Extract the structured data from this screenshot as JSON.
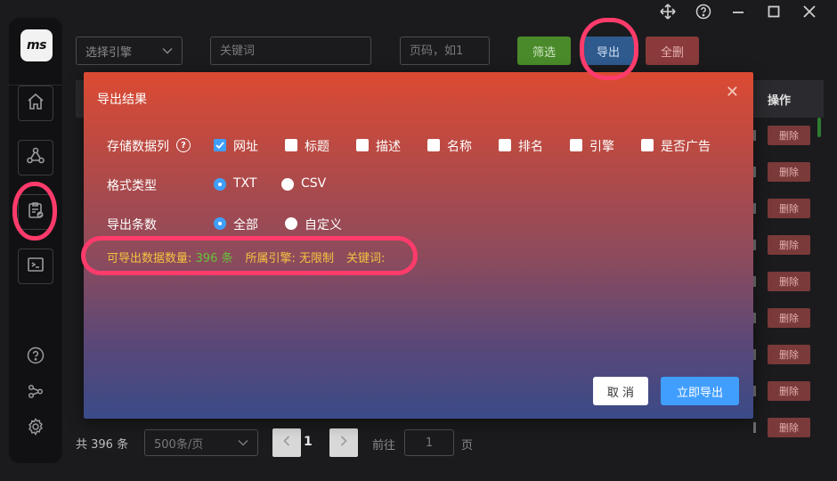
{
  "window_controls": [
    "move-icon",
    "help-circle-icon",
    "minimize-icon",
    "maximize-icon",
    "close-icon"
  ],
  "sidebar": {
    "logo_text": "ms",
    "items": [
      {
        "icon": "home-icon"
      },
      {
        "icon": "share-nodes-icon"
      },
      {
        "icon": "clipboard-check-icon",
        "active": true
      },
      {
        "icon": "terminal-icon"
      }
    ],
    "bottom_icons": [
      "question-circle-icon",
      "nodes-icon",
      "gear-icon"
    ]
  },
  "toolbar": {
    "engine_placeholder": "选择引擎",
    "keyword_placeholder": "关键词",
    "page_placeholder": "页码，如1",
    "filter_label": "筛选",
    "export_label": "导出",
    "delete_all_label": "全删"
  },
  "table": {
    "op_header": "操作",
    "delete_label": "删除",
    "row_count": 9
  },
  "pagination": {
    "total_text": "共 396 条",
    "page_size": "500条/页",
    "current_page": "1",
    "goto_label": "前往",
    "goto_value": "1",
    "goto_suffix": "页"
  },
  "dialog": {
    "title": "导出结果",
    "columns_label": "存储数据列",
    "columns": [
      {
        "label": "网址",
        "checked": true
      },
      {
        "label": "标题",
        "checked": false
      },
      {
        "label": "描述",
        "checked": false
      },
      {
        "label": "名称",
        "checked": false
      },
      {
        "label": "排名",
        "checked": false
      },
      {
        "label": "引擎",
        "checked": false
      },
      {
        "label": "是否广告",
        "checked": false
      }
    ],
    "format_label": "格式类型",
    "formats": [
      {
        "label": "TXT",
        "checked": true
      },
      {
        "label": "CSV",
        "checked": false
      }
    ],
    "count_label": "导出条数",
    "count_options": [
      {
        "label": "全部",
        "checked": true
      },
      {
        "label": "自定义",
        "checked": false
      }
    ],
    "summary": {
      "count_prefix": "可导出数据数量:",
      "count_value": "396 条",
      "engine_text": "所属引擎: 无限制",
      "keyword_text": "关键词:"
    },
    "cancel_label": "取 消",
    "confirm_label": "立即导出"
  },
  "colors": {
    "accent": "#409eff",
    "filter_green": "#4a8a2a",
    "export_blue": "#2f5a8e",
    "delete_red": "#8a3a3a",
    "annotation": "#ff3b6b",
    "summary_text": "#f5c242",
    "count_green": "#67c23a"
  }
}
